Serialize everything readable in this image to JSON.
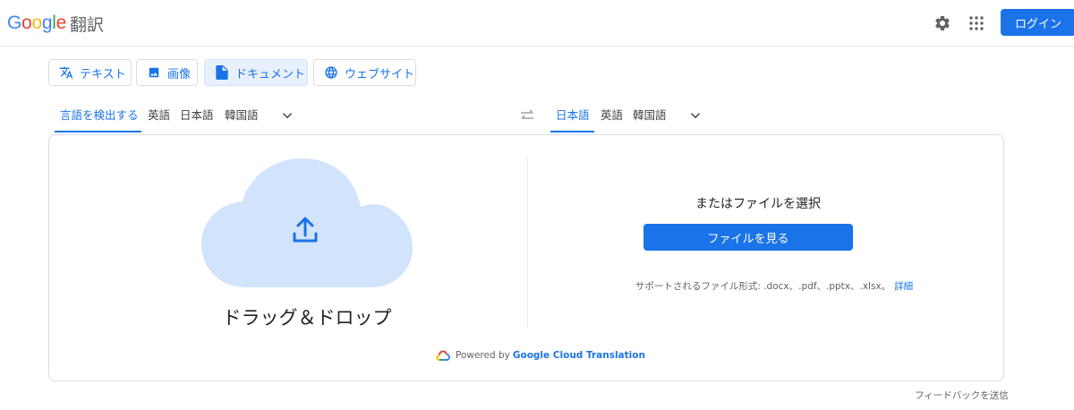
{
  "header": {
    "logo_letters": [
      "G",
      "o",
      "o",
      "g",
      "l",
      "e"
    ],
    "logo_colors": [
      "#4285F4",
      "#EA4335",
      "#FBBC05",
      "#4285F4",
      "#34A853",
      "#EA4335"
    ],
    "product_name": "翻訳",
    "login_label": "ログイン",
    "settings_icon": "gear-icon",
    "apps_icon": "apps-grid-icon"
  },
  "mode_tabs": [
    {
      "label": "テキスト",
      "icon": "translate-icon",
      "active": false
    },
    {
      "label": "画像",
      "icon": "image-icon",
      "active": false
    },
    {
      "label": "ドキュメント",
      "icon": "document-icon",
      "active": true
    },
    {
      "label": "ウェブサイト",
      "icon": "globe-icon",
      "active": false
    }
  ],
  "source_langs": [
    "言語を検出する",
    "英語",
    "日本語",
    "韓国語"
  ],
  "target_langs": [
    "日本語",
    "英語",
    "韓国語"
  ],
  "upload": {
    "drag_drop": "ドラッグ＆ドロップ",
    "or_choose": "またはファイルを選択",
    "browse_label": "ファイルを見る",
    "supported_text": "サポートされるファイル形式: .docx、.pdf、.pptx、.xlsx。",
    "details_link": "詳細",
    "powered_by": "Powered by",
    "powered_brand": "Google Cloud Translation"
  },
  "feedback": "フィードバックを送信",
  "colors": {
    "accent": "#1a73e8",
    "active_tab_bg": "#e8f0fe",
    "cloud": "#d2e3fc"
  }
}
